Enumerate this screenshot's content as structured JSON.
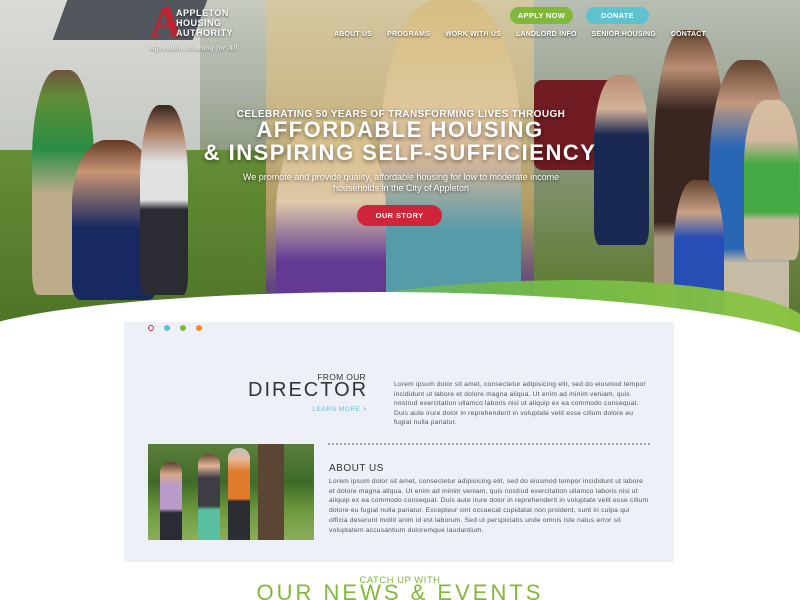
{
  "header": {
    "logo": {
      "mark": "A",
      "lines": [
        "APPLETON",
        "HOUSING",
        "AUTHORITY"
      ],
      "tagline": "Affordable Housing for All"
    },
    "apply_label": "APPLY NOW",
    "donate_label": "DONATE",
    "nav": [
      "ABOUT US",
      "PROGRAMS",
      "WORK WITH US",
      "LANDLORD INFO",
      "SENIOR HOUSING",
      "CONTACT"
    ]
  },
  "hero": {
    "kicker": "CELEBRATING 50 YEARS OF TRANSFORMING LIVES THROUGH",
    "title_line1": "AFFORDABLE HOUSING",
    "title_line2": "& INSPIRING SELF-SUFFICIENCY",
    "subtitle": "We promote and provide quality, affordable housing for low to moderate income households in the City of Appleton",
    "cta_label": "OUR STORY",
    "slider_dots": 4
  },
  "director": {
    "heading_small": "FROM OUR",
    "heading_big": "DIRECTOR",
    "learn_more": "LEARN MORE >",
    "body": "Lorem ipsum dolor sit amet, consectetur adipisicing elit, sed do eiusmod tempor incididunt ut labore et dolore magna aliqua. Ut enim ad minim veniam, quis nostrud exercitation ullamco laboris nisi ut aliquip ex ea commodo consequat. Duis aute irure dolor in reprehenderit in voluptate velit esse cillum dolore eu fugiat nulla pariatur."
  },
  "about": {
    "title": "ABOUT US",
    "body": "Lorem ipsum dolor sit amet, consectetur adipisicing elit, sed do eiusmod tempor incididunt ut labore et dolore magna aliqua. Ut enim ad minim veniam, quis nostrud exercitation ullamco laboris nisi ut aliquip ex ea commodo consequat. Duis aute irure dolor in reprehenderit in voluptate velit esse cillum dolore eu fugiat nulla pariatur. Excepteur sint occaecat cupidatat non proident, sunt in culpa qui officia deserunt mollit anim id est laborum. Sed ut perspiciatis unde omnis iste natus error sit voluptatem accusantium doloremque laudantium."
  },
  "news": {
    "heading_small": "CATCH UP WITH",
    "heading_big": "OUR NEWS & EVENTS"
  },
  "colors": {
    "brand_red": "#d0243a",
    "green": "#7fb83b",
    "teal": "#5ec2d0",
    "orange": "#f08a2a",
    "card_bg": "#eef0f8"
  }
}
